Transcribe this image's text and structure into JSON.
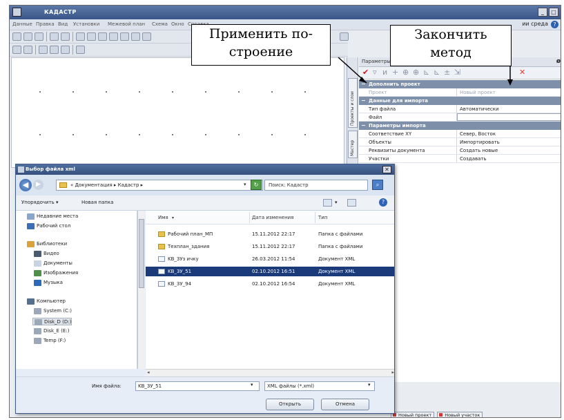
{
  "window": {
    "title": "КАДАСТР",
    "env_label": "ии среда"
  },
  "menubar": {
    "items": [
      "Данные",
      "Правка",
      "Вид",
      "Установки",
      "Межевой план",
      "Схема",
      "Окно",
      "Справка"
    ]
  },
  "callouts": {
    "apply": "Применить по-\nстроение",
    "finish": "Закончить\nметод"
  },
  "right_panel": {
    "title": "Параметры",
    "vtabs": [
      "Проекты и слои",
      "Мастер"
    ],
    "groups": [
      {
        "title": "Дополнить проект",
        "rows": [
          {
            "name": "Проект",
            "value": "Новый проект",
            "dim": true
          }
        ]
      },
      {
        "title": "Данные для импорта",
        "rows": [
          {
            "name": "Тип файла",
            "value": "Автоматически"
          },
          {
            "name": "Файл",
            "value": ""
          }
        ]
      },
      {
        "title": "Параметры импорта",
        "rows": [
          {
            "name": "Соответствие XY",
            "value": "Север, Восток"
          },
          {
            "name": "Объекты",
            "value": "Импортировать"
          },
          {
            "name": "Реквизиты документа",
            "value": "Создать новые"
          },
          {
            "name": "Участки",
            "value": "Создавать"
          }
        ]
      }
    ]
  },
  "status_tabs": [
    "Новый проект",
    "Новый участок"
  ],
  "dialog": {
    "title": "Выбор файла xml",
    "path": "« Документация ▸ Кадастр ▸",
    "search_placeholder": "Поиск: Кадастр",
    "organize": "Упорядочить ▾",
    "new_folder": "Новая папка",
    "nav": [
      {
        "label": "Недавние места",
        "color": "#8aa6cf"
      },
      {
        "label": "Рабочий стол",
        "color": "#3a6fb8"
      },
      {
        "label": "Библиотеки",
        "color": "#d9a23a"
      },
      {
        "label": "Видео",
        "color": "#4a5a6f"
      },
      {
        "label": "Документы",
        "color": "#c8d4e3"
      },
      {
        "label": "Изображения",
        "color": "#4f8f4a"
      },
      {
        "label": "Музыка",
        "color": "#2d6bb8"
      },
      {
        "label": "Компьютер",
        "color": "#55708f"
      },
      {
        "label": "System (C:)",
        "color": "#9aa8ba"
      },
      {
        "label": "Disk_D (D:)",
        "color": "#9aa8ba",
        "selected": true
      },
      {
        "label": "Disk_E (E:)",
        "color": "#9aa8ba"
      },
      {
        "label": "Temp (F:)",
        "color": "#9aa8ba"
      }
    ],
    "columns": {
      "name": "Имя",
      "date": "Дата изменения",
      "type": "Тип"
    },
    "files": [
      {
        "name": "Рабочий план_МП",
        "date": "15.11.2012 22:17",
        "type": "Папка с файлами",
        "kind": "folder"
      },
      {
        "name": "Техплан_здания",
        "date": "15.11.2012 22:17",
        "type": "Папка с файлами",
        "kind": "folder"
      },
      {
        "name": "KB_3Уз ичку",
        "date": "26.03.2012 11:54",
        "type": "Документ XML",
        "kind": "xml"
      },
      {
        "name": "KB_3У_51",
        "date": "02.10.2012 16:51",
        "type": "Документ XML",
        "kind": "xml",
        "selected": true
      },
      {
        "name": "KB_3У_94",
        "date": "02.10.2012 16:54",
        "type": "Документ XML",
        "kind": "xml"
      }
    ],
    "filename_label": "Имя файла:",
    "filename_value": "KB_3У_51",
    "filetype_value": "XML файлы (*.xml)",
    "open_label": "Открыть",
    "cancel_label": "Отмена"
  }
}
